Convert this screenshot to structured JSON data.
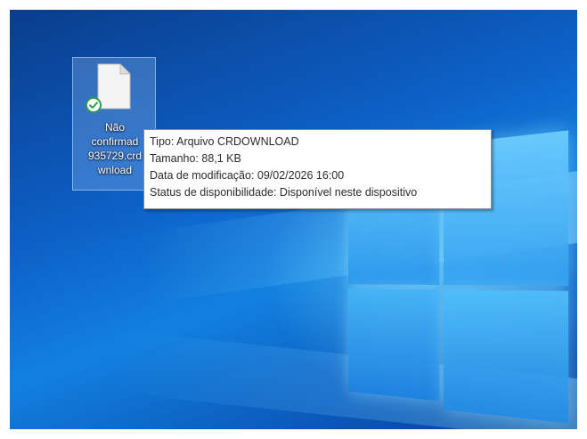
{
  "desktop_icon": {
    "label_lines": [
      "Não",
      "confirmad",
      "935729.crd",
      "wnload"
    ],
    "file_icon": "blank-file-icon",
    "status_icon": "sync-ok-check-icon"
  },
  "tooltip": {
    "type_line": "Tipo: Arquivo CRDOWNLOAD",
    "size_line": "Tamanho: 88,1 KB",
    "modified_line": "Data de modificação: 09/02/2026 16:00",
    "availability_line": "Status de disponibilidade: Disponível neste dispositivo"
  },
  "colors": {
    "wallpaper_dark": "#0a3d8c",
    "wallpaper_light": "#1280e0",
    "sync_ok": "#2e9e4f",
    "tooltip_border": "#8a8a8a"
  },
  "wallpaper_icon": "windows-logo-icon"
}
